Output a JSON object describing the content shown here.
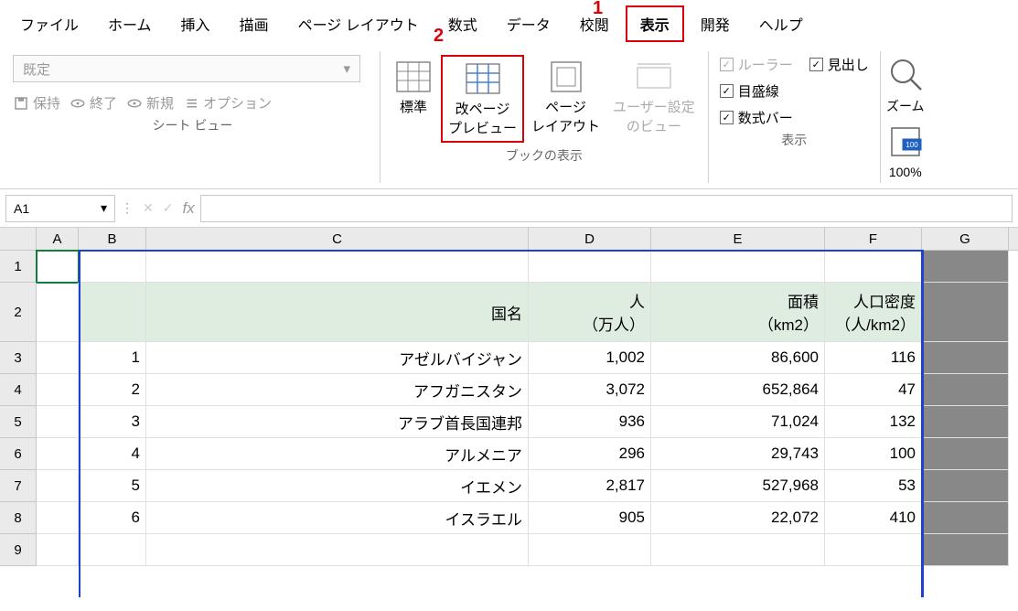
{
  "annotations": {
    "a1": "1",
    "a2": "2"
  },
  "menu": {
    "file": "ファイル",
    "home": "ホーム",
    "insert": "挿入",
    "draw": "描画",
    "page_layout": "ページ レイアウト",
    "formulas": "数式",
    "data": "データ",
    "review": "校閲",
    "view": "表示",
    "developer": "開発",
    "help": "ヘルプ"
  },
  "ribbon": {
    "sheet_view": {
      "default": "既定",
      "keep": "保持",
      "exit": "終了",
      "new": "新規",
      "options": "オプション",
      "label": "シート ビュー"
    },
    "book_view": {
      "normal": "標準",
      "page_break": "改ページ\nプレビュー",
      "page_layout": "ページ\nレイアウト",
      "custom": "ユーザー設定\nのビュー",
      "label": "ブックの表示"
    },
    "show": {
      "ruler": "ルーラー",
      "headings": "見出し",
      "gridlines": "目盛線",
      "formula_bar": "数式バー",
      "label": "表示"
    },
    "zoom": {
      "zoom": "ズーム",
      "hundred": "100%"
    }
  },
  "formula_bar": {
    "name_box": "A1",
    "fx": "fx"
  },
  "columns": {
    "A": "A",
    "B": "B",
    "C": "C",
    "D": "D",
    "E": "E",
    "F": "F",
    "G": "G"
  },
  "row_headers": [
    "1",
    "2",
    "3",
    "4",
    "5",
    "6",
    "7",
    "8",
    "9"
  ],
  "table": {
    "headers": {
      "country": "国名",
      "pop": "人\n（万人）",
      "area": "面積\n（km2）",
      "density": "人口密度\n（人/km2）"
    },
    "rows": [
      {
        "n": "1",
        "country": "アゼルバイジャン",
        "pop": "1,002",
        "area": "86,600",
        "density": "116"
      },
      {
        "n": "2",
        "country": "アフガニスタン",
        "pop": "3,072",
        "area": "652,864",
        "density": "47"
      },
      {
        "n": "3",
        "country": "アラブ首長国連邦",
        "pop": "936",
        "area": "71,024",
        "density": "132"
      },
      {
        "n": "4",
        "country": "アルメニア",
        "pop": "296",
        "area": "29,743",
        "density": "100"
      },
      {
        "n": "5",
        "country": "イエメン",
        "pop": "2,817",
        "area": "527,968",
        "density": "53"
      },
      {
        "n": "6",
        "country": "イスラエル",
        "pop": "905",
        "area": "22,072",
        "density": "410"
      }
    ]
  }
}
